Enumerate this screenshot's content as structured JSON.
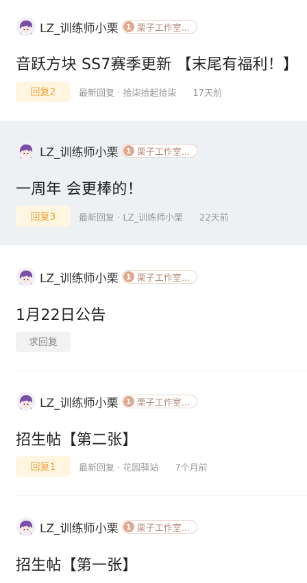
{
  "posts": [
    {
      "author": "LZ_训练师小栗",
      "level": "1",
      "group": "栗子工作室...",
      "title": "音跃方块 SS7赛季更新 【末尾有福利！】",
      "reply_label": "回复2",
      "latest_reply": "最新回复 · 拾柒拾起拾柒",
      "time": "17天前"
    },
    {
      "author": "LZ_训练师小栗",
      "level": "1",
      "group": "栗子工作室...",
      "title": "一周年 会更棒的！",
      "reply_label": "回复3",
      "latest_reply": "最新回复 · LZ_训练师小栗",
      "time": "22天前"
    },
    {
      "author": "LZ_训练师小栗",
      "level": "1",
      "group": "栗子工作室...",
      "title": "1月22日公告",
      "reply_label": "求回复"
    },
    {
      "author": "LZ_训练师小栗",
      "level": "1",
      "group": "栗子工作室...",
      "title": "招生帖【第二张】",
      "reply_label": "回复1",
      "latest_reply": "最新回复 · 花园驿站",
      "time": "7个月前"
    },
    {
      "author": "LZ_训练师小栗",
      "level": "1",
      "group": "栗子工作室...",
      "title": "招生帖【第一张】"
    }
  ],
  "colors": {
    "highlight_bg": "#eef1f4",
    "reply_badge_bg": "#fff5e1",
    "reply_badge_text": "#f0a43a",
    "group_tag_border": "#ecd0c4",
    "level_badge_bg": "#e0a98f"
  }
}
